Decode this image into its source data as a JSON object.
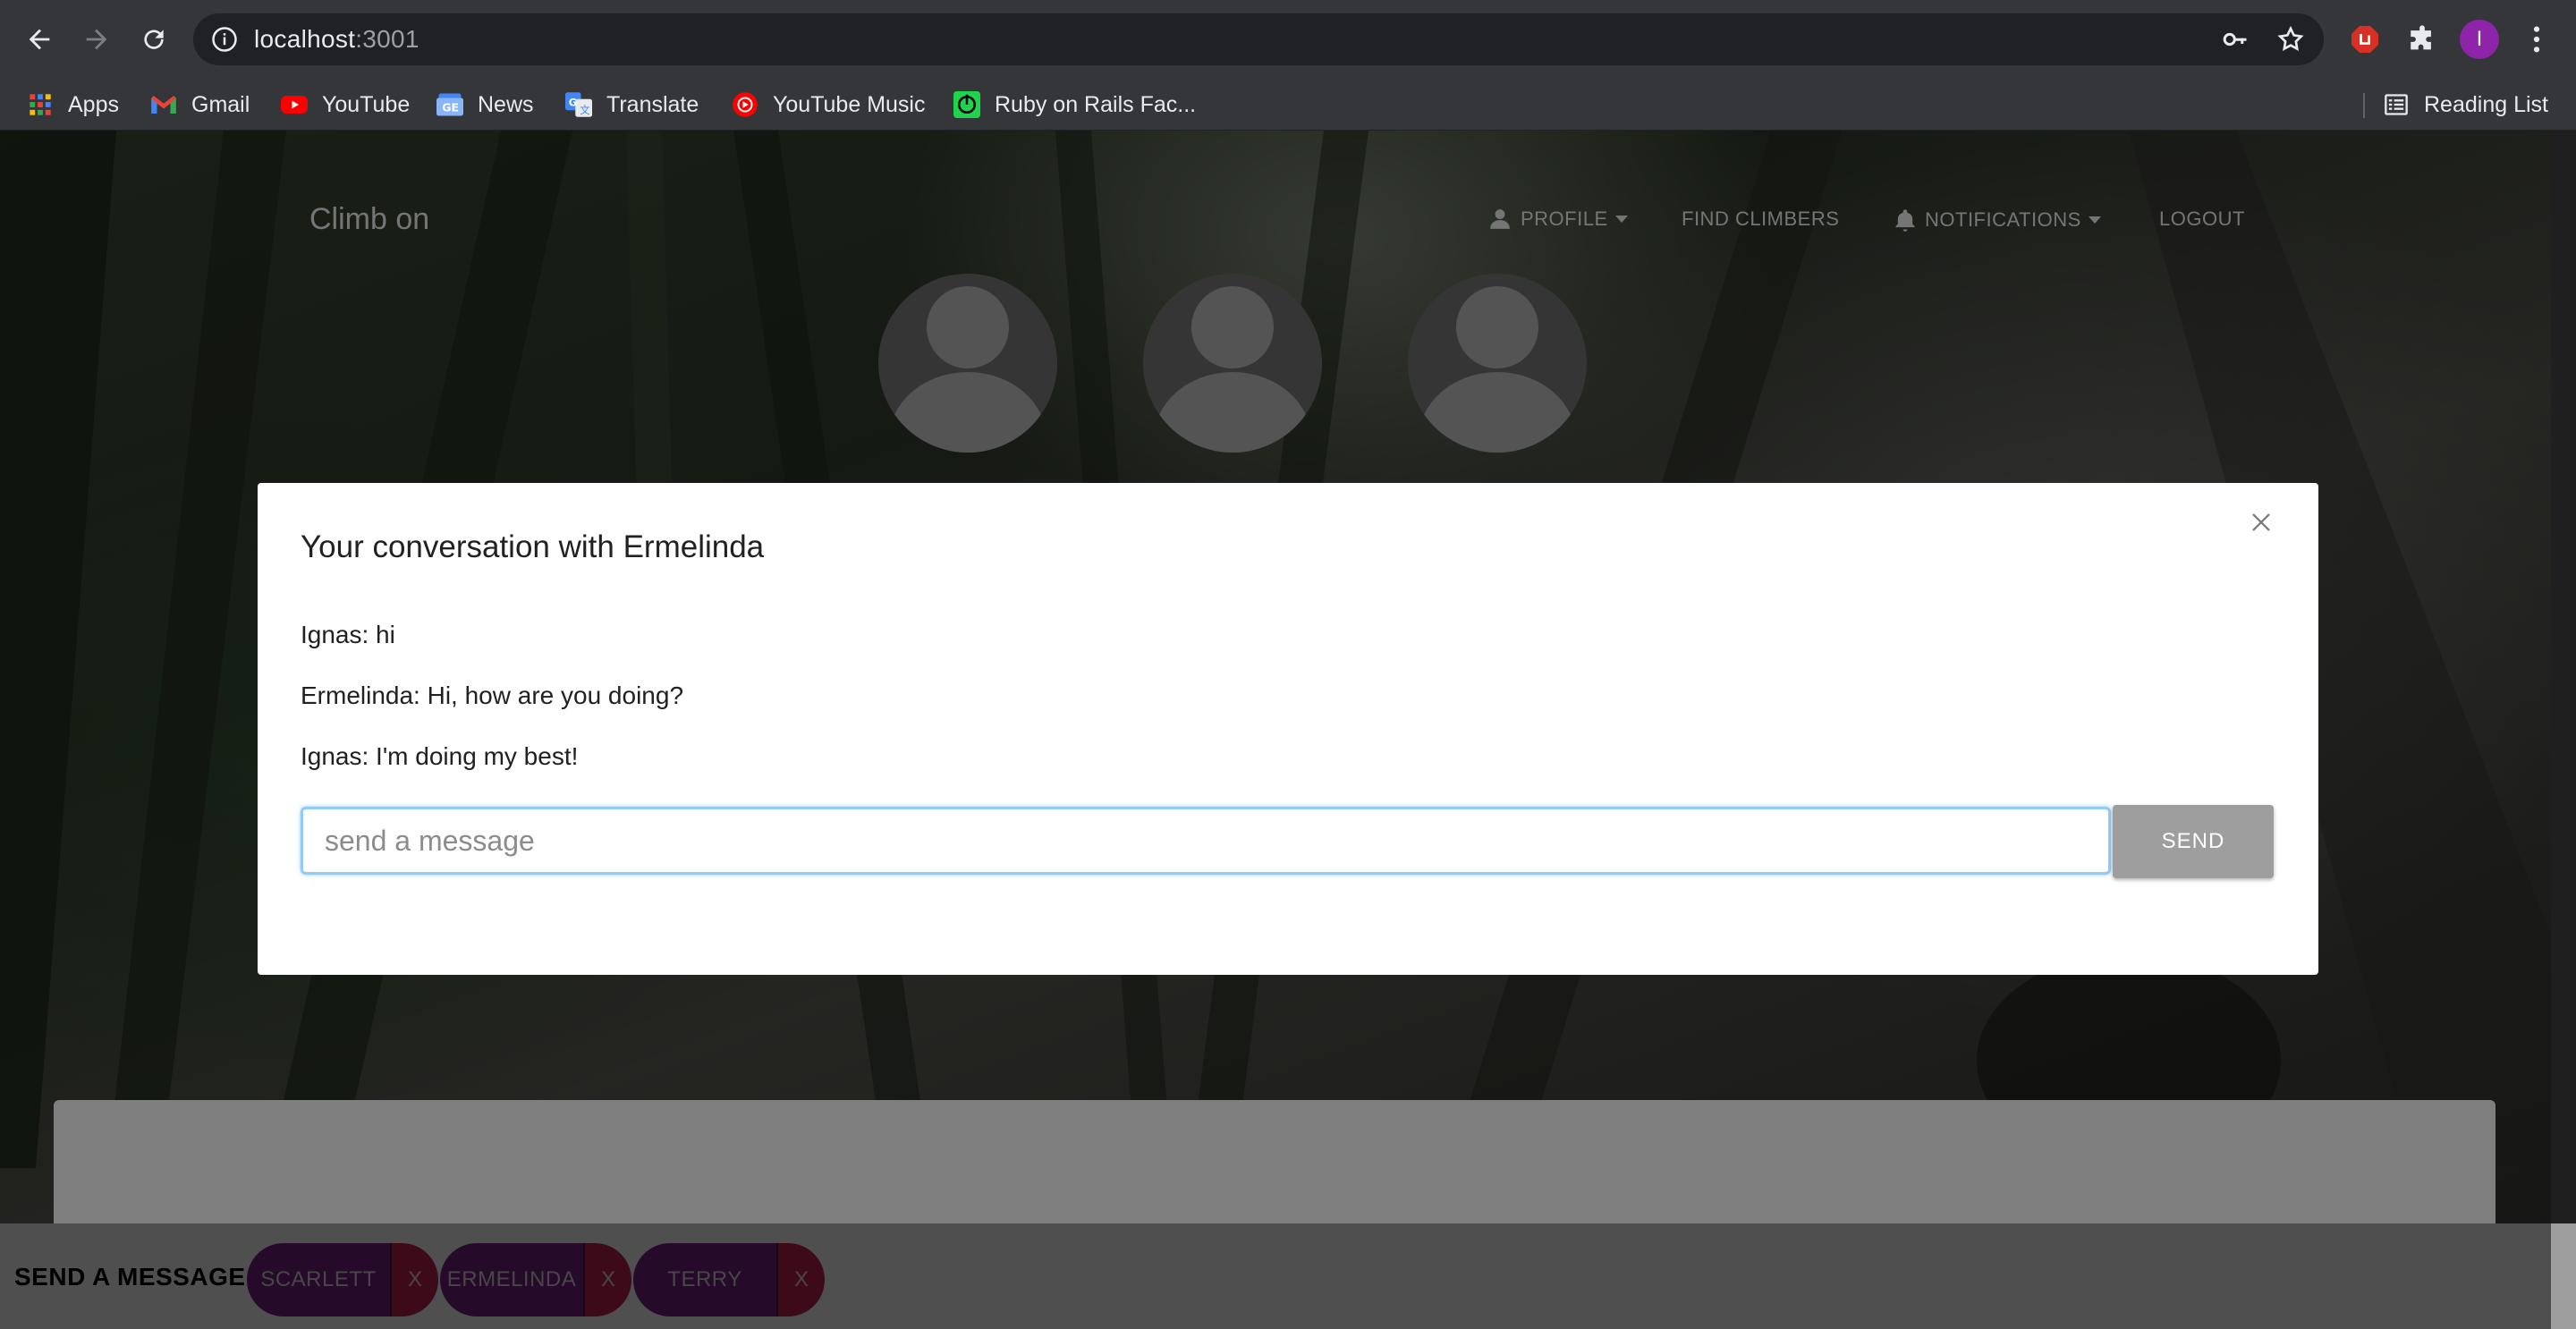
{
  "browser": {
    "url_host": "localhost",
    "url_port": ":3001",
    "profile_initial": "I",
    "bookmarks": [
      {
        "label": "Apps",
        "icon": "apps-grid-icon"
      },
      {
        "label": "Gmail",
        "icon": "gmail-icon"
      },
      {
        "label": "YouTube",
        "icon": "youtube-icon"
      },
      {
        "label": "News",
        "icon": "google-news-icon"
      },
      {
        "label": "Translate",
        "icon": "google-translate-icon"
      },
      {
        "label": "YouTube Music",
        "icon": "youtube-music-icon"
      },
      {
        "label": "Ruby on Rails Fac...",
        "icon": "rails-factory-icon"
      }
    ],
    "reading_list": "Reading List"
  },
  "site": {
    "brand": "Climb on",
    "nav": {
      "profile": "PROFILE",
      "find_climbers": "FIND CLIMBERS",
      "notifications": "NOTIFICATIONS",
      "logout": "LOGOUT"
    }
  },
  "modal": {
    "title": "Your conversation with Ermelinda",
    "messages": [
      {
        "text": "Ignas: hi"
      },
      {
        "text": "Ermelinda: Hi, how are you doing?"
      },
      {
        "text": "Ignas: I'm doing my best!"
      }
    ],
    "input_placeholder": "send a message",
    "send_label": "SEND"
  },
  "chatbar": {
    "label": "SEND A MESSAGE",
    "chips": [
      {
        "name": "SCARLETT",
        "close": "X"
      },
      {
        "name": "ERMELINDA",
        "close": "X"
      },
      {
        "name": "TERRY",
        "close": "X"
      }
    ]
  },
  "colors": {
    "chip_name_bg": "#4a1552",
    "chip_close_bg": "#7a1535",
    "send_button_bg": "#9e9e9e",
    "input_focus_border": "#90caf9"
  }
}
